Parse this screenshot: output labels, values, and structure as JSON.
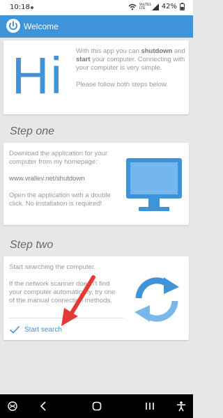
{
  "status_bar": {
    "time": "10:18",
    "signal_label": "VoLTE1 LTE",
    "battery": "42%"
  },
  "app_bar": {
    "title": "Welcome"
  },
  "welcome_card": {
    "big_text": "Hi",
    "intro_parts": [
      "With this app you can ",
      "shutdown",
      " and ",
      "start",
      " your computer. Connecting with your computer is very simple."
    ],
    "follow": "Please follow both steps below."
  },
  "step_one": {
    "heading": "Step one",
    "p1": "Download the application for your computer from my homepage:",
    "url": "www.vrallev.net/shutdown",
    "p2": "Open the application with a double click. No installation is required!"
  },
  "step_two": {
    "heading": "Step two",
    "p1": "Start searching the computer.",
    "p2": "If the network scanner doesn't find your computer automatically, try one of the manual connection methods.",
    "button": "Start search"
  },
  "colors": {
    "accent": "#3f93d9",
    "arrow": "#e53935",
    "background": "#e7e7e7"
  },
  "icons": [
    "power-icon",
    "monitor-icon",
    "sync-icon",
    "check-icon",
    "wifi-icon",
    "battery-icon"
  ]
}
